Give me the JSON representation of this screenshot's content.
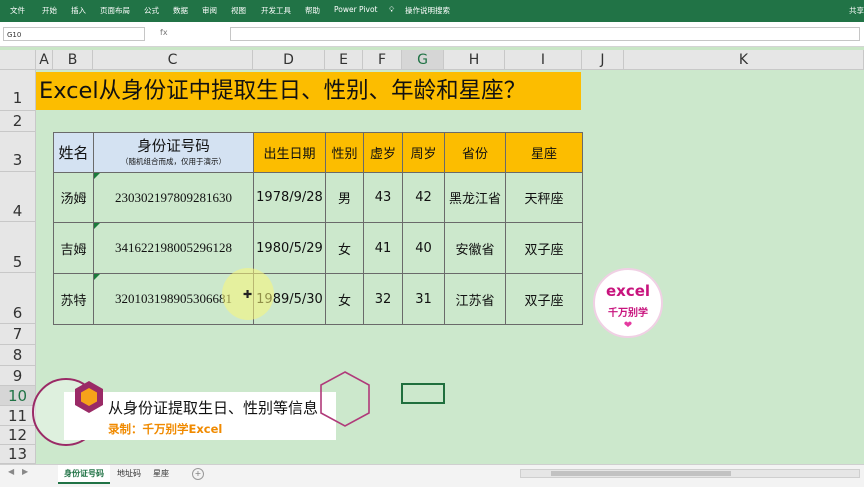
{
  "ribbon": {
    "tabs": [
      "文件",
      "开始",
      "插入",
      "页面布局",
      "公式",
      "数据",
      "审阅",
      "视图",
      "开发工具",
      "帮助",
      "Power Pivot",
      "操作说明搜索"
    ],
    "share": "共享"
  },
  "formula_bar": {
    "name_box": "G10",
    "fx": "fx",
    "value": ""
  },
  "columns": [
    "A",
    "B",
    "C",
    "D",
    "E",
    "F",
    "G",
    "H",
    "I",
    "J",
    "K"
  ],
  "rows": [
    "1",
    "2",
    "3",
    "4",
    "5",
    "6",
    "7",
    "8",
    "9",
    "10",
    "11",
    "12",
    "13"
  ],
  "title": "Excel从身份证中提取生日、性别、年龄和星座？",
  "table": {
    "headers": {
      "name": "姓名",
      "id_main": "身份证号码",
      "id_sub": "（随机组合而成，仅用于演示）",
      "birth": "出生日期",
      "gender": "性别",
      "nominal_age": "虚岁",
      "actual_age": "周岁",
      "province": "省份",
      "zodiac": "星座"
    },
    "rows": [
      {
        "name": "汤姆",
        "id": "230302197809281630",
        "birth": "1978/9/28",
        "gender": "男",
        "nominal_age": "43",
        "actual_age": "42",
        "province": "黑龙江省",
        "zodiac": "天秤座"
      },
      {
        "name": "吉姆",
        "id": "341622198005296128",
        "birth": "1980/5/29",
        "gender": "女",
        "nominal_age": "41",
        "actual_age": "40",
        "province": "安徽省",
        "zodiac": "双子座"
      },
      {
        "name": "苏特",
        "id": "320103198905306681",
        "birth": "1989/5/30",
        "gender": "女",
        "nominal_age": "32",
        "actual_age": "31",
        "province": "江苏省",
        "zodiac": "双子座"
      }
    ]
  },
  "logo": {
    "line1": "excel",
    "line2": "千万别学"
  },
  "banner": {
    "line1": "从身份证提取生日、性别等信息",
    "line2": "录制：千万别学Excel"
  },
  "sheet_tabs": [
    "身份证号码",
    "地址码",
    "星座"
  ],
  "active_sheet": "身份证号码",
  "colors": {
    "excel_green": "#217346",
    "title_fill": "#fcbd00",
    "sheet_bg": "#cce8cc",
    "header_blue": "#d4e2f2",
    "brand_pink": "#c8137d"
  }
}
